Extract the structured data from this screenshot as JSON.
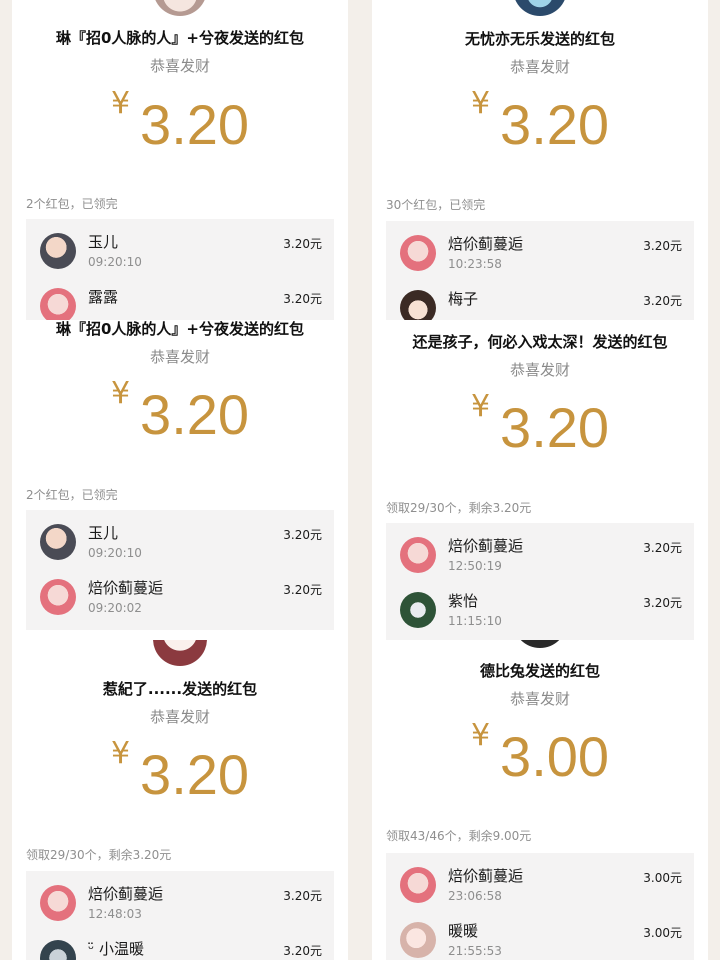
{
  "panels": [
    {
      "title": "琳『招0人脉的人』+兮夜发送的红包",
      "greeting": "恭喜发财",
      "currency": "¥",
      "amount": "3.20",
      "summary": "2个红包，已领完",
      "rows": [
        {
          "name": "玉儿",
          "time": "09:20:10",
          "amount": "3.20元"
        },
        {
          "name": "露露",
          "time": "",
          "amount": "3.20元"
        }
      ]
    },
    {
      "title": "无忧亦无乐发送的红包",
      "greeting": "恭喜发财",
      "currency": "¥",
      "amount": "3.20",
      "summary": "30个红包，已领完",
      "rows": [
        {
          "name": "焙伱蓟蔓逅",
          "time": "10:23:58",
          "amount": "3.20元"
        },
        {
          "name": "梅子",
          "time": "",
          "amount": "3.20元"
        }
      ]
    },
    {
      "title": "琳『招0人脉的人』+兮夜发送的红包",
      "greeting": "恭喜发财",
      "currency": "¥",
      "amount": "3.20",
      "summary": "2个红包，已领完",
      "rows": [
        {
          "name": "玉儿",
          "time": "09:20:10",
          "amount": "3.20元"
        },
        {
          "name": "焙伱蓟蔓逅",
          "time": "09:20:02",
          "amount": "3.20元"
        }
      ]
    },
    {
      "title": "还是孩子，何必入戏太深！发送的红包",
      "greeting": "恭喜发财",
      "currency": "¥",
      "amount": "3.20",
      "summary": "领取29/30个，剩余3.20元",
      "rows": [
        {
          "name": "焙伱蓟蔓逅",
          "time": "12:50:19",
          "amount": "3.20元"
        },
        {
          "name": "紫怡",
          "time": "11:15:10",
          "amount": "3.20元"
        }
      ]
    },
    {
      "title": "惹紀了......发送的红包",
      "greeting": "恭喜发财",
      "currency": "¥",
      "amount": "3.20",
      "summary": "领取29/30个，剩余3.20元",
      "rows": [
        {
          "name": "焙伱蓟蔓逅",
          "time": "12:48:03",
          "amount": "3.20元"
        },
        {
          "name": "ᵕ̈ 小温暖",
          "time": "",
          "amount": "3.20元"
        }
      ]
    },
    {
      "title": "德比兔发送的红包",
      "greeting": "恭喜发财",
      "currency": "¥",
      "amount": "3.00",
      "summary": "领取43/46个，剩余9.00元",
      "rows": [
        {
          "name": "焙伱蓟蔓逅",
          "time": "23:06:58",
          "amount": "3.00元"
        },
        {
          "name": "暖暖",
          "time": "21:55:53",
          "amount": "3.00元"
        }
      ]
    }
  ]
}
